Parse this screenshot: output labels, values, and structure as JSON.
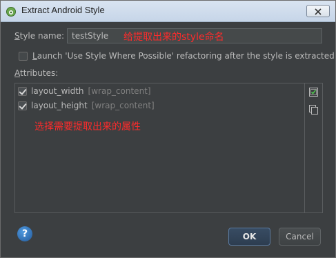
{
  "window": {
    "title": "Extract Android Style",
    "close_icon": "close-icon",
    "app_icon": "android-studio-icon"
  },
  "style_name": {
    "label_mnemonic": "S",
    "label_rest": "tyle name:",
    "value": "testStyle"
  },
  "annotations": {
    "style_name_note": "给提取出来的style命名",
    "attributes_note": "选择需要提取出来的属性"
  },
  "launch_option": {
    "checked": false,
    "label_mnemonic": "L",
    "label_rest": "aunch 'Use Style Where Possible' refactoring after the style is extracted"
  },
  "attributes": {
    "label_mnemonic": "A",
    "label_rest": "ttributes:",
    "items": [
      {
        "checked": true,
        "name": "layout_width",
        "value": "[wrap_content]"
      },
      {
        "checked": true,
        "name": "layout_height",
        "value": "[wrap_content]"
      }
    ],
    "select_all_icon": "select-all-icon",
    "copy_icon": "copy-icon"
  },
  "buttons": {
    "help": "?",
    "ok": "OK",
    "cancel": "Cancel"
  },
  "colors": {
    "background": "#3c3f41",
    "annotation": "#ff2b2b",
    "accent": "#5b7aa0"
  }
}
